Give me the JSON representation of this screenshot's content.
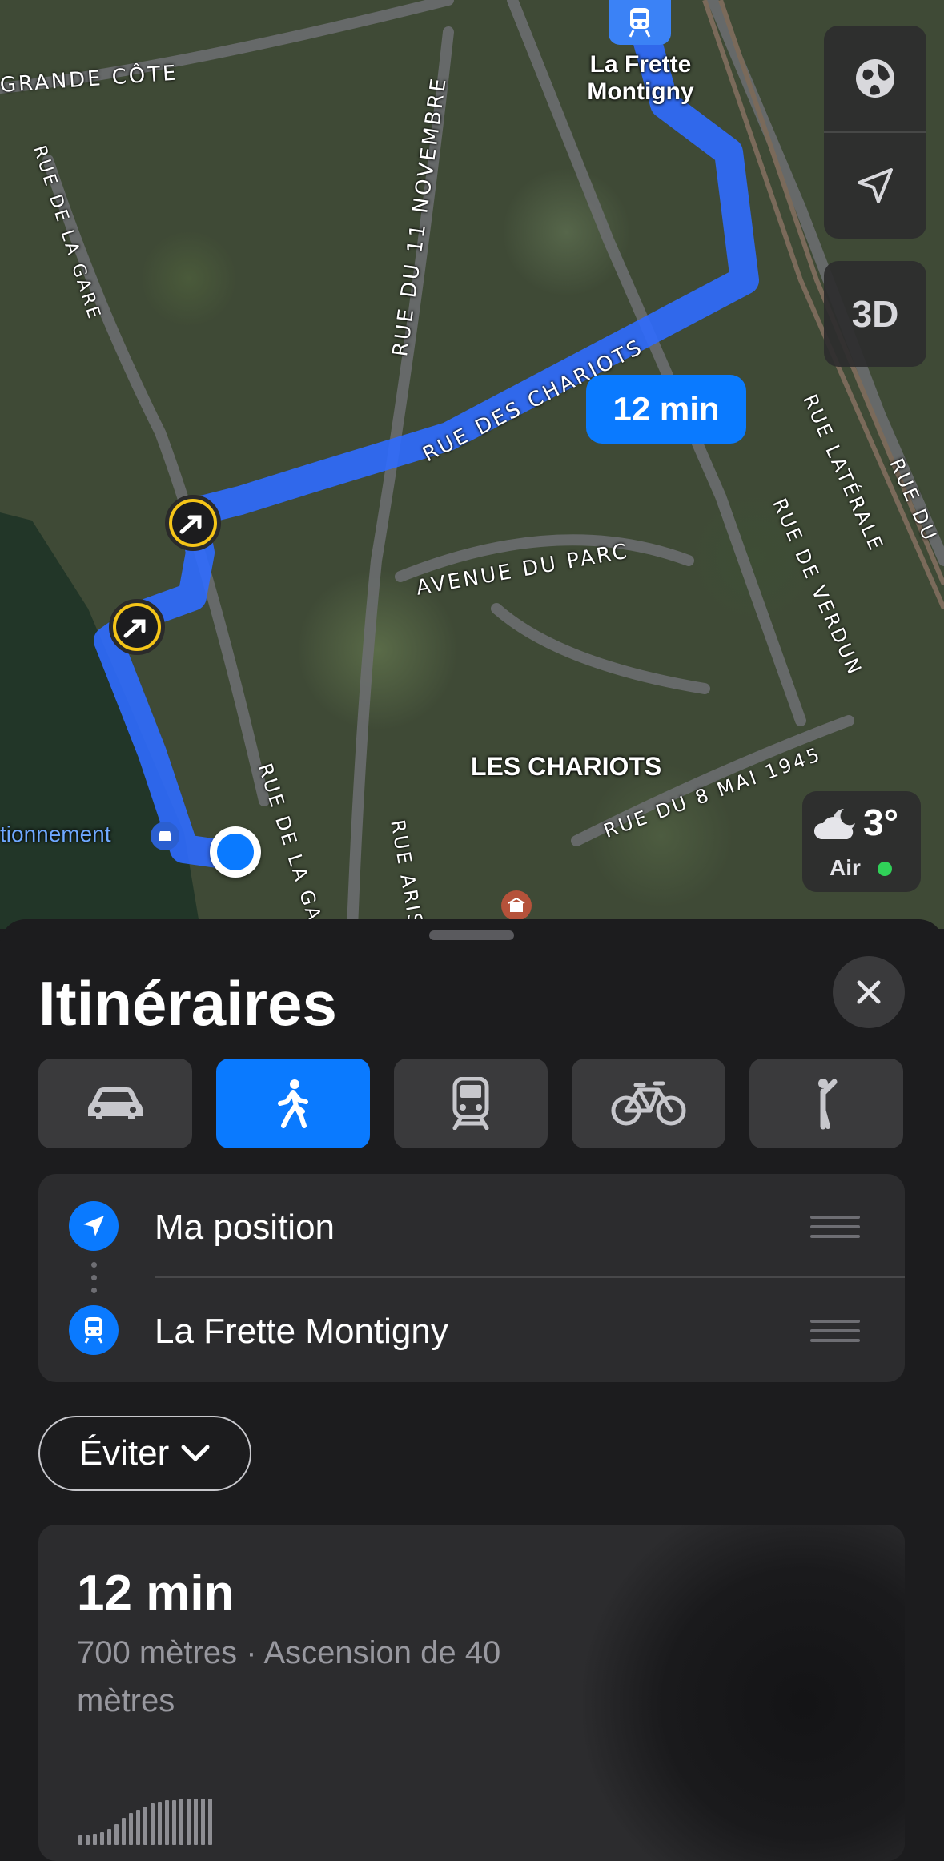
{
  "map": {
    "street_labels": [
      "GRANDE CÔTE",
      "RUE DE LA GARE",
      "RUE DU 11 NOVEMBRE",
      "RUE DES CHARIOTS",
      "AVENUE DU PARC",
      "RUE LATÉRALE",
      "RUE DE VERDUN",
      "RUE DU",
      "RUE DE LA GA",
      "RUE ARIS",
      "RUE DU 8 MAI 1945"
    ],
    "area_label": "LES CHARIOTS",
    "parking_label": "tionnement",
    "destination_label_line1": "La Frette",
    "destination_label_line2": "Montigny",
    "route_time_badge": "12 min",
    "controls": {
      "globe_icon": "globe-icon",
      "location_icon": "location-arrow-icon",
      "three_d_label": "3D"
    },
    "weather": {
      "temperature": "3°",
      "air_label": "Air",
      "air_status_color": "#30d158"
    },
    "route_color": "#2f6bff"
  },
  "sheet": {
    "title": "Itinéraires",
    "modes": [
      {
        "name": "car",
        "icon": "car-icon",
        "active": false
      },
      {
        "name": "walk",
        "icon": "walk-icon",
        "active": true
      },
      {
        "name": "transit",
        "icon": "train-icon",
        "active": false
      },
      {
        "name": "bike",
        "icon": "bicycle-icon",
        "active": false
      },
      {
        "name": "ride",
        "icon": "person-hail-icon",
        "active": false
      }
    ],
    "origin": "Ma position",
    "destination": "La Frette Montigny",
    "avoid_label": "Éviter",
    "result": {
      "time": "12 min",
      "description": "700 mètres · Ascension de 40 mètres"
    }
  },
  "colors": {
    "accent": "#0a7aff",
    "sheet_bg": "#1c1c1e",
    "card_bg": "#2c2c2e"
  }
}
